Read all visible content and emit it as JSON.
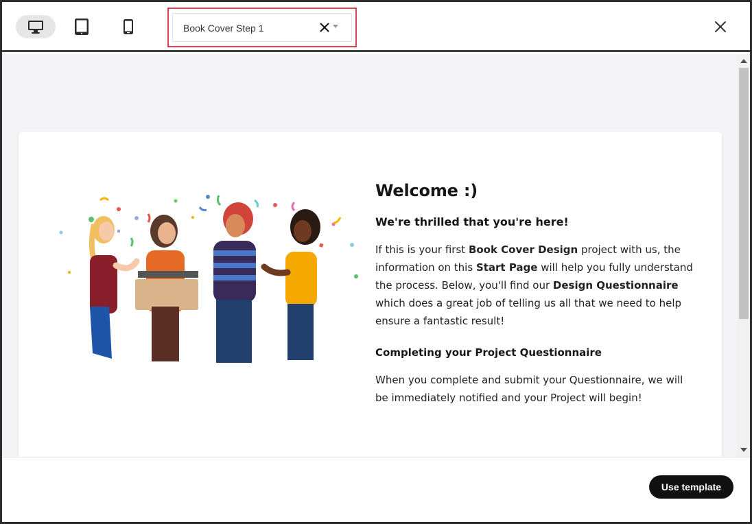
{
  "toolbar": {
    "devices": [
      "desktop",
      "tablet",
      "mobile"
    ],
    "active_device": "desktop",
    "template_select": {
      "value": "Book Cover Step 1"
    }
  },
  "preview": {
    "welcome_title": "Welcome  :)",
    "subheading": "We're thrilled that you're here!",
    "intro": {
      "t1": "If this is your first ",
      "b1": "Book Cover Design",
      "t2": " project with us, the information on this ",
      "b2": "Start Page",
      "t3": " will help you fully understand the process. Below, you'll find our ",
      "b3": "Design Questionnaire",
      "t4": " which does a great job of telling us all that we need to help ensure a fantastic result!"
    },
    "section_heading": "Completing your Project Questionnaire",
    "section_text": "When you complete and submit your Questionnaire, we will be immediately notified and your Project will begin!"
  },
  "footer": {
    "use_template_label": "Use template"
  },
  "colors": {
    "accent_outline": "#e0434b",
    "button_bg": "#111111"
  }
}
